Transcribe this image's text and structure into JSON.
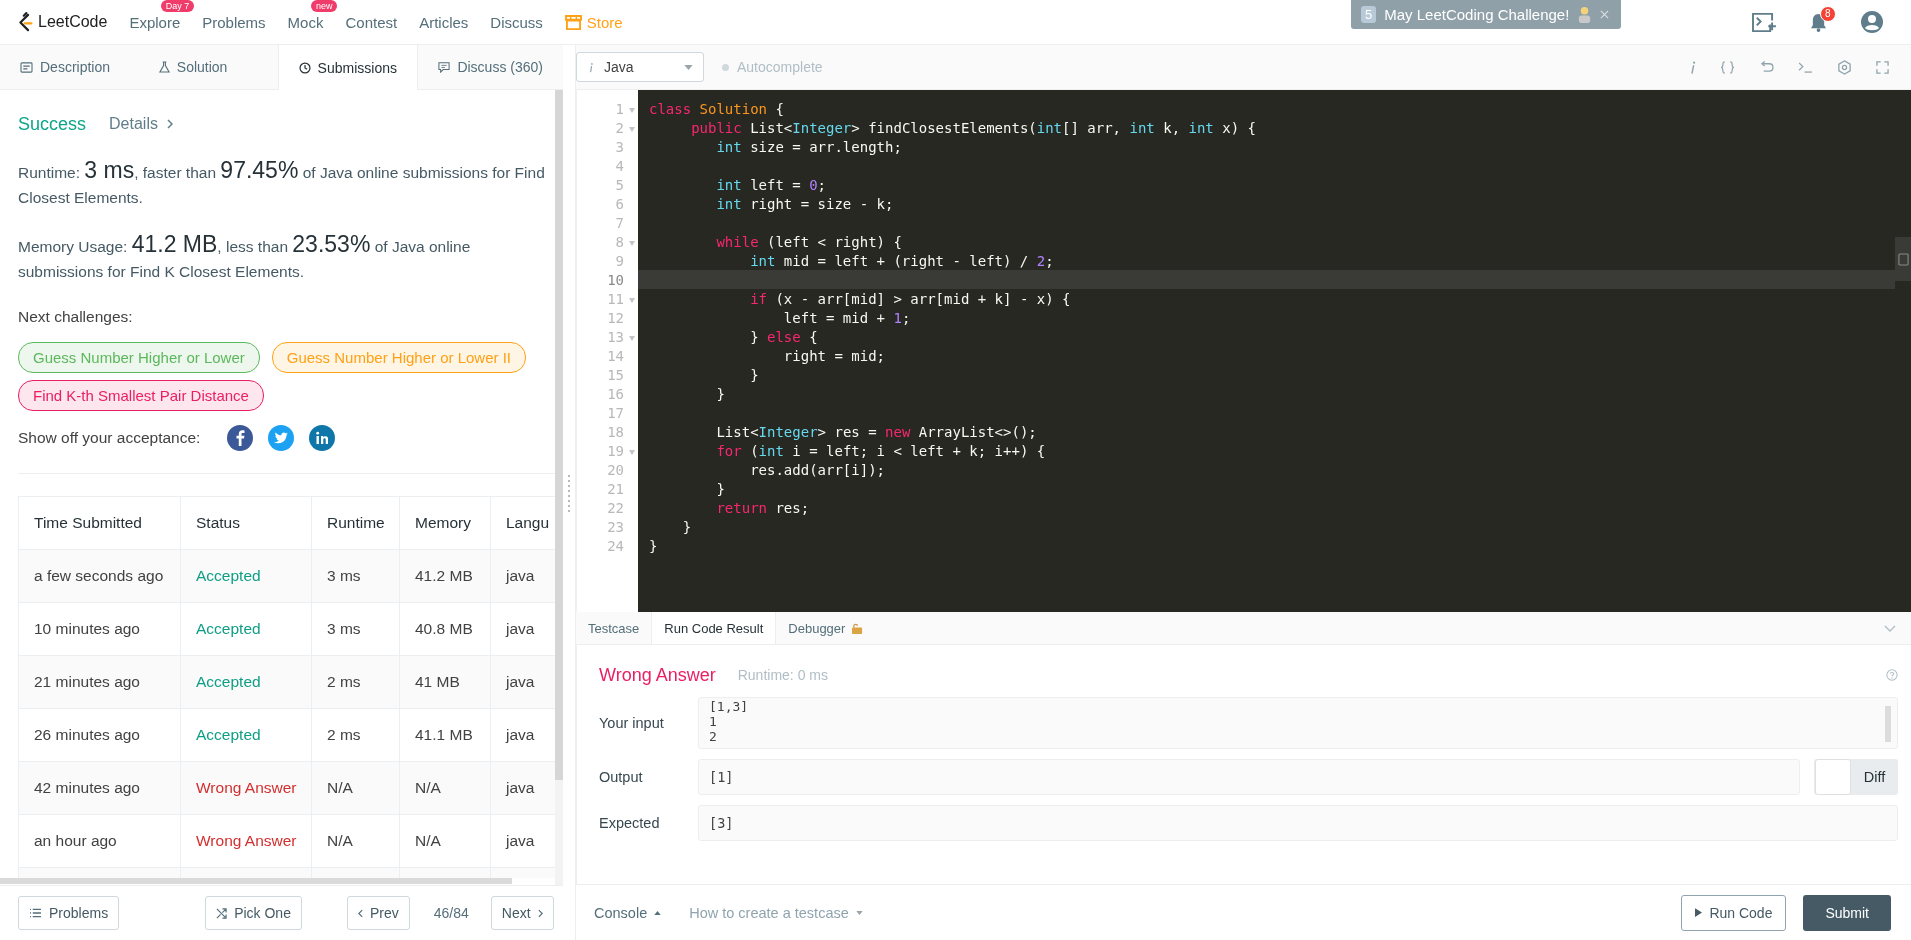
{
  "nav": {
    "brand": "LeetCode",
    "items": [
      {
        "label": "Explore",
        "kind": "link",
        "badge": "Day 7"
      },
      {
        "label": "Problems",
        "kind": "link"
      },
      {
        "label": "Mock",
        "kind": "link",
        "badge": "new"
      },
      {
        "label": "Contest",
        "kind": "link"
      },
      {
        "label": "Articles",
        "kind": "link"
      },
      {
        "label": "Discuss",
        "kind": "link"
      },
      {
        "label": "Store",
        "kind": "store"
      }
    ],
    "banner": {
      "number": "5",
      "text": "May LeetCoding Challenge!"
    },
    "notification_count": "8"
  },
  "left_tabs": [
    {
      "label": "Description",
      "selected": false
    },
    {
      "label": "Solution",
      "selected": false
    },
    {
      "label": "Submissions",
      "selected": true
    },
    {
      "label": "Discuss (360)",
      "selected": false
    }
  ],
  "result": {
    "status": "Success",
    "details": "Details",
    "paragraphs": [
      "Runtime: **3 ms**, faster than **97.45%** of Java online submissions for Find Closest Elements.",
      "Memory Usage: **41.2 MB**, less than **23.53%** of Java online submissions for Find K Closest Elements."
    ],
    "next_label": "Next challenges:",
    "challenges": [
      {
        "label": "Guess Number Higher or Lower",
        "color": "#5cb85c"
      },
      {
        "label": "Guess Number Higher or Lower II",
        "color": "#ffa116"
      },
      {
        "label": "Find K-th Smallest Pair Distance",
        "color": "#e91e63"
      }
    ],
    "share_label": "Show off your acceptance:"
  },
  "table": {
    "columns": [
      "Time Submitted",
      "Status",
      "Runtime",
      "Memory",
      "Langu"
    ],
    "rows": [
      {
        "time": "a few seconds ago",
        "status": "Accepted",
        "kind": "accepted",
        "runtime": "3 ms",
        "memory": "41.2 MB",
        "language": "java"
      },
      {
        "time": "10 minutes ago",
        "status": "Accepted",
        "kind": "accepted",
        "runtime": "3 ms",
        "memory": "40.8 MB",
        "language": "java"
      },
      {
        "time": "21 minutes ago",
        "status": "Accepted",
        "kind": "accepted",
        "runtime": "2 ms",
        "memory": "41 MB",
        "language": "java"
      },
      {
        "time": "26 minutes ago",
        "status": "Accepted",
        "kind": "accepted",
        "runtime": "2 ms",
        "memory": "41.1 MB",
        "language": "java"
      },
      {
        "time": "42 minutes ago",
        "status": "Wrong Answer",
        "kind": "wrong",
        "runtime": "N/A",
        "memory": "N/A",
        "language": "java"
      },
      {
        "time": "an hour ago",
        "status": "Wrong Answer",
        "kind": "wrong",
        "runtime": "N/A",
        "memory": "N/A",
        "language": "java"
      }
    ]
  },
  "left_footer": {
    "problems": "Problems",
    "pick": "Pick One",
    "prev": "Prev",
    "page": "46/84",
    "next": "Next"
  },
  "editor": {
    "language": "Java",
    "autocomplete": {
      "label": "Autocomplete",
      "on": false
    },
    "lines": [
      {
        "number": "1",
        "foldable": true,
        "current": false,
        "tokens": [
          {
            "kind": "keyword",
            "text": "class "
          },
          {
            "kind": "classname",
            "text": "Solution"
          },
          {
            "kind": "plain",
            "text": " {"
          }
        ]
      },
      {
        "number": "2",
        "foldable": true,
        "current": false,
        "tokens": [
          {
            "kind": "keyword",
            "text": "     public"
          },
          {
            "kind": "plain",
            "text": " List<"
          },
          {
            "kind": "type",
            "text": "Integer"
          },
          {
            "kind": "plain",
            "text": "> findClosestElements("
          },
          {
            "kind": "type",
            "text": "int"
          },
          {
            "kind": "plain",
            "text": "[] arr, "
          },
          {
            "kind": "type",
            "text": "int"
          },
          {
            "kind": "plain",
            "text": " k, "
          },
          {
            "kind": "type",
            "text": "int"
          },
          {
            "kind": "plain",
            "text": " x) {"
          }
        ]
      },
      {
        "number": "3",
        "foldable": false,
        "current": false,
        "tokens": [
          {
            "kind": "type",
            "text": "        int"
          },
          {
            "kind": "plain",
            "text": " size = arr.length;"
          }
        ]
      },
      {
        "number": "4",
        "foldable": false,
        "current": false
      },
      {
        "number": "5",
        "foldable": false,
        "current": false,
        "tokens": [
          {
            "kind": "type",
            "text": "        int"
          },
          {
            "kind": "plain",
            "text": " left = "
          },
          {
            "kind": "number",
            "text": "0"
          },
          {
            "kind": "plain",
            "text": ";"
          }
        ]
      },
      {
        "number": "6",
        "foldable": false,
        "current": false,
        "tokens": [
          {
            "kind": "type",
            "text": "        int"
          },
          {
            "kind": "plain",
            "text": " right = size - k;"
          }
        ]
      },
      {
        "number": "7",
        "foldable": false,
        "current": false
      },
      {
        "number": "8",
        "foldable": true,
        "current": false,
        "tokens": [
          {
            "kind": "keyword",
            "text": "        while"
          },
          {
            "kind": "plain",
            "text": " (left < right) {"
          }
        ]
      },
      {
        "number": "9",
        "foldable": false,
        "current": false,
        "tokens": [
          {
            "kind": "type",
            "text": "            int"
          },
          {
            "kind": "plain",
            "text": " mid = left + (right - left) / "
          },
          {
            "kind": "number",
            "text": "2"
          },
          {
            "kind": "plain",
            "text": ";"
          }
        ]
      },
      {
        "number": "10",
        "foldable": false,
        "current": true
      },
      {
        "number": "11",
        "foldable": true,
        "current": false,
        "tokens": [
          {
            "kind": "keyword",
            "text": "            if"
          },
          {
            "kind": "plain",
            "text": " (x - arr[mid] > arr[mid + k] - x) {"
          }
        ]
      },
      {
        "number": "12",
        "foldable": false,
        "current": false,
        "tokens": [
          {
            "kind": "plain",
            "text": "                left = mid + "
          },
          {
            "kind": "number",
            "text": "1"
          },
          {
            "kind": "plain",
            "text": ";"
          }
        ]
      },
      {
        "number": "13",
        "foldable": true,
        "current": false,
        "tokens": [
          {
            "kind": "plain",
            "text": "            } "
          },
          {
            "kind": "keyword",
            "text": "else"
          },
          {
            "kind": "plain",
            "text": " {"
          }
        ]
      },
      {
        "number": "14",
        "foldable": false,
        "current": false,
        "tokens": [
          {
            "kind": "plain",
            "text": "                right = mid;"
          }
        ]
      },
      {
        "number": "15",
        "foldable": false,
        "current": false,
        "tokens": [
          {
            "kind": "plain",
            "text": "            }"
          }
        ]
      },
      {
        "number": "16",
        "foldable": false,
        "current": false,
        "tokens": [
          {
            "kind": "plain",
            "text": "        }"
          }
        ]
      },
      {
        "number": "17",
        "foldable": false,
        "current": false
      },
      {
        "number": "18",
        "foldable": false,
        "current": false,
        "tokens": [
          {
            "kind": "plain",
            "text": "        List<"
          },
          {
            "kind": "type",
            "text": "Integer"
          },
          {
            "kind": "plain",
            "text": "> res = "
          },
          {
            "kind": "keyword",
            "text": "new"
          },
          {
            "kind": "plain",
            "text": " ArrayList<>();"
          }
        ]
      },
      {
        "number": "19",
        "foldable": true,
        "current": false,
        "tokens": [
          {
            "kind": "keyword",
            "text": "        for"
          },
          {
            "kind": "plain",
            "text": " ("
          },
          {
            "kind": "type",
            "text": "int"
          },
          {
            "kind": "plain",
            "text": " i = left; i < left + k; i++) {"
          }
        ]
      },
      {
        "number": "20",
        "foldable": false,
        "current": false,
        "tokens": [
          {
            "kind": "plain",
            "text": "            res.add(arr[i]);"
          }
        ]
      },
      {
        "number": "21",
        "foldable": false,
        "current": false,
        "tokens": [
          {
            "kind": "plain",
            "text": "        }"
          }
        ]
      },
      {
        "number": "22",
        "foldable": false,
        "current": false,
        "tokens": [
          {
            "kind": "keyword",
            "text": "        return"
          },
          {
            "kind": "plain",
            "text": " res;"
          }
        ]
      },
      {
        "number": "23",
        "foldable": false,
        "current": false,
        "tokens": [
          {
            "kind": "plain",
            "text": "    }"
          }
        ]
      },
      {
        "number": "24",
        "foldable": false,
        "current": false,
        "tokens": [
          {
            "kind": "plain",
            "text": "}"
          }
        ]
      }
    ]
  },
  "console_tabs": [
    {
      "label": "Testcase",
      "selected": false
    },
    {
      "label": "Run Code Result",
      "selected": true
    },
    {
      "label": "Debugger",
      "selected": false
    }
  ],
  "run_result": {
    "verdict": "Wrong Answer",
    "runtime": "Runtime: 0 ms",
    "input_label": "Your input",
    "input_lines": [
      "[1,3]",
      "1",
      "2"
    ],
    "output_label": "Output",
    "output": "[1]",
    "diff": {
      "label": "Diff",
      "on": false
    },
    "expected_label": "Expected",
    "expected": "[3]"
  },
  "right_footer": {
    "console": "Console",
    "howto": "How to create a testcase",
    "run": "Run Code",
    "submit": "Submit"
  }
}
